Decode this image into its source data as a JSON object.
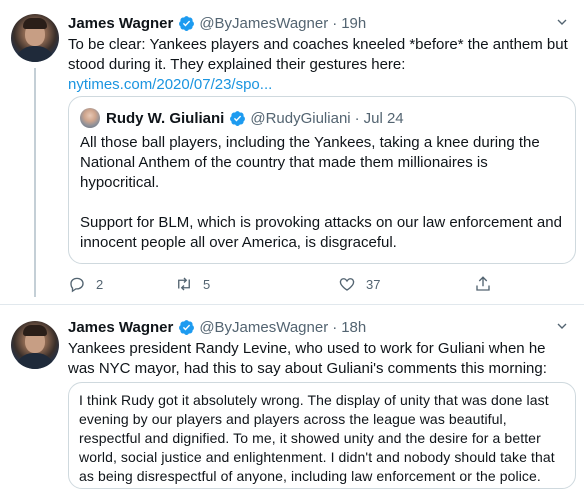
{
  "colors": {
    "accent": "#1d9bf0",
    "link": "#1b95e0",
    "secondary": "#536471",
    "border": "#cfd9de"
  },
  "tweets": [
    {
      "name": "James Wagner",
      "handle": "@ByJamesWagner",
      "separator": "·",
      "time": "19h",
      "text": "To be clear: Yankees players and coaches kneeled *before* the anthem but stood during it. They explained their gestures here:",
      "link": "nytimes.com/2020/07/23/spo...",
      "quote": {
        "name": "Rudy W. Giuliani",
        "handle": "@RudyGiuliani",
        "separator": "·",
        "time": "Jul 24",
        "paragraph1": "All those ball players, including the Yankees,  taking a knee during the National Anthem of the country that made them millionaires is hypocritical.",
        "paragraph2": "Support for  BLM, which is provoking attacks on our law enforcement and innocent people all over America, is disgraceful."
      },
      "actions": {
        "replies": "2",
        "retweets": "5",
        "likes": "37"
      },
      "icons": {
        "reply": "reply-icon",
        "retweet": "retweet-icon",
        "like": "heart-icon",
        "share": "share-icon"
      }
    },
    {
      "name": "James Wagner",
      "handle": "@ByJamesWagner",
      "separator": "·",
      "time": "18h",
      "text": "Yankees president Randy Levine, who used to work for Guliani when he was NYC mayor, had this to say about Guliani's comments this morning:",
      "quote_text": "I think Rudy got it absolutely wrong. The display of unity that was done last evening by our players and players across the league was beautiful, respectful and dignified. To me, it showed unity and the desire for a better world, social justice and enlightenment. I didn't and nobody should take that as being disrespectful of anyone, including law enforcement or the police."
    }
  ]
}
